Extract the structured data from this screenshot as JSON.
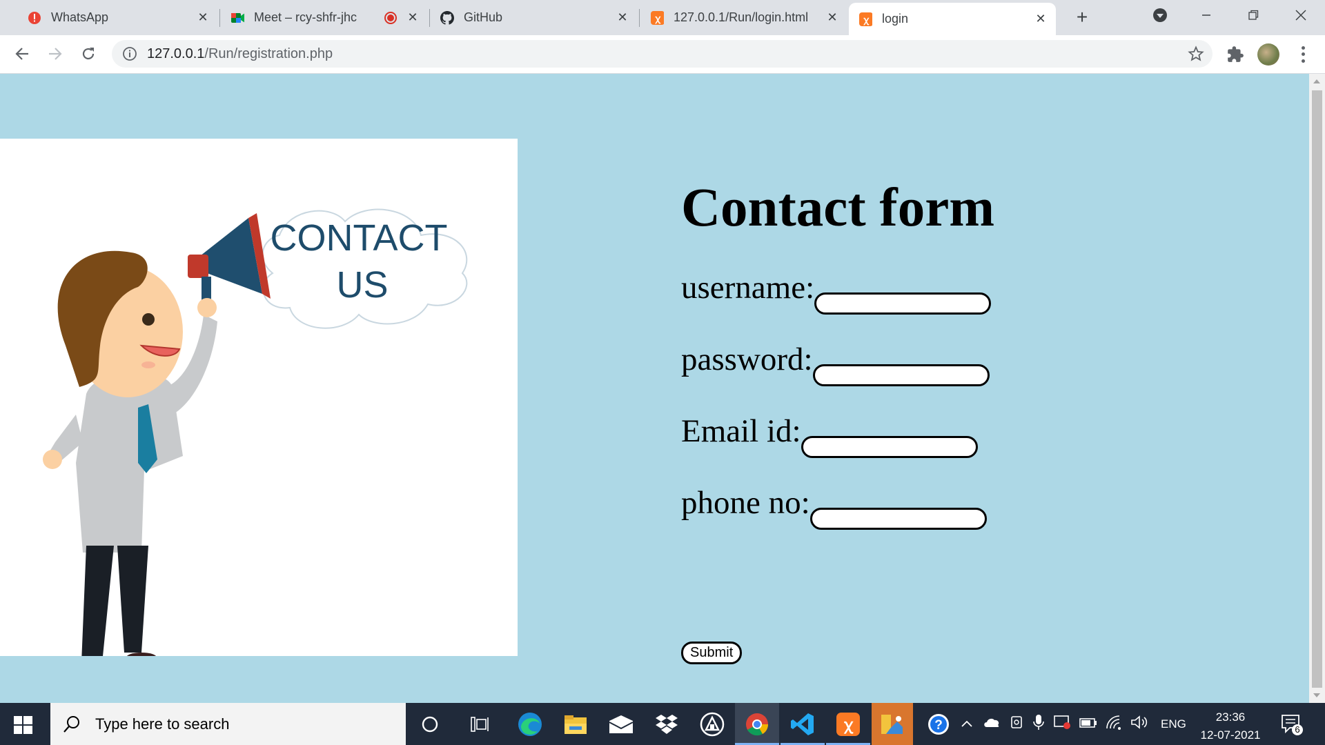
{
  "browser": {
    "tabs": [
      {
        "title": "WhatsApp",
        "icon": "whatsapp-alert-icon"
      },
      {
        "title": "Meet – rcy-shfr-jhc",
        "icon": "google-meet-icon",
        "recording": true
      },
      {
        "title": "GitHub",
        "icon": "github-icon"
      },
      {
        "title": "127.0.0.1/Run/login.html",
        "icon": "xampp-icon"
      },
      {
        "title": "login",
        "icon": "xampp-icon",
        "active": true
      }
    ],
    "url_host": "127.0.0.1",
    "url_path": "/Run/registration.php"
  },
  "page": {
    "background": "#add8e6",
    "image_text": "CONTACT US",
    "form_title": "Contact form",
    "fields": [
      {
        "label": "username:",
        "value": ""
      },
      {
        "label": "password:",
        "value": ""
      },
      {
        "label": "Email id:",
        "value": ""
      },
      {
        "label": "phone no:",
        "value": ""
      }
    ],
    "submit_label": "Submit"
  },
  "taskbar": {
    "search_placeholder": "Type here to search",
    "language": "ENG",
    "time": "23:36",
    "date": "12-07-2021",
    "notification_count": "6"
  }
}
